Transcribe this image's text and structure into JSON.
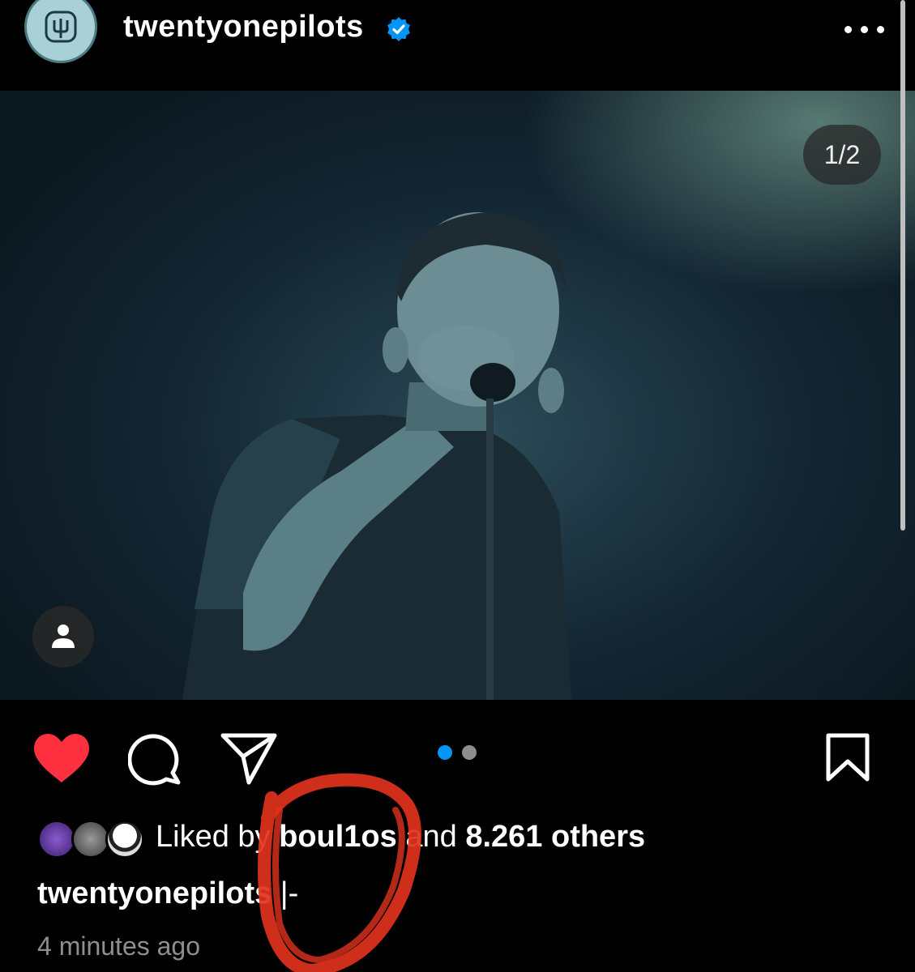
{
  "post": {
    "username": "twentyonepilots",
    "verified": true,
    "photo_counter": "1/2",
    "likes": {
      "prefix": "Liked by",
      "user": "boul1os",
      "and": "and",
      "others": "8.261 others"
    },
    "caption": {
      "username": "twentyonepilots",
      "text": "|-"
    },
    "timestamp": "4 minutes ago",
    "carousel": {
      "current": 1,
      "total": 2
    }
  },
  "icons": {
    "like": "heart-filled-icon",
    "comment": "comment-icon",
    "share": "send-icon",
    "save": "bookmark-icon",
    "more": "ellipsis-icon",
    "tag": "user-tag-icon",
    "verified": "verified-badge-icon"
  },
  "colors": {
    "background": "#000000",
    "heart": "#ff3040",
    "active_dot": "#0095f6",
    "inactive_dot": "#8e8e8e",
    "verified": "#0095f6",
    "scribble": "#e0321c",
    "muted_text": "#8e8e8e"
  }
}
